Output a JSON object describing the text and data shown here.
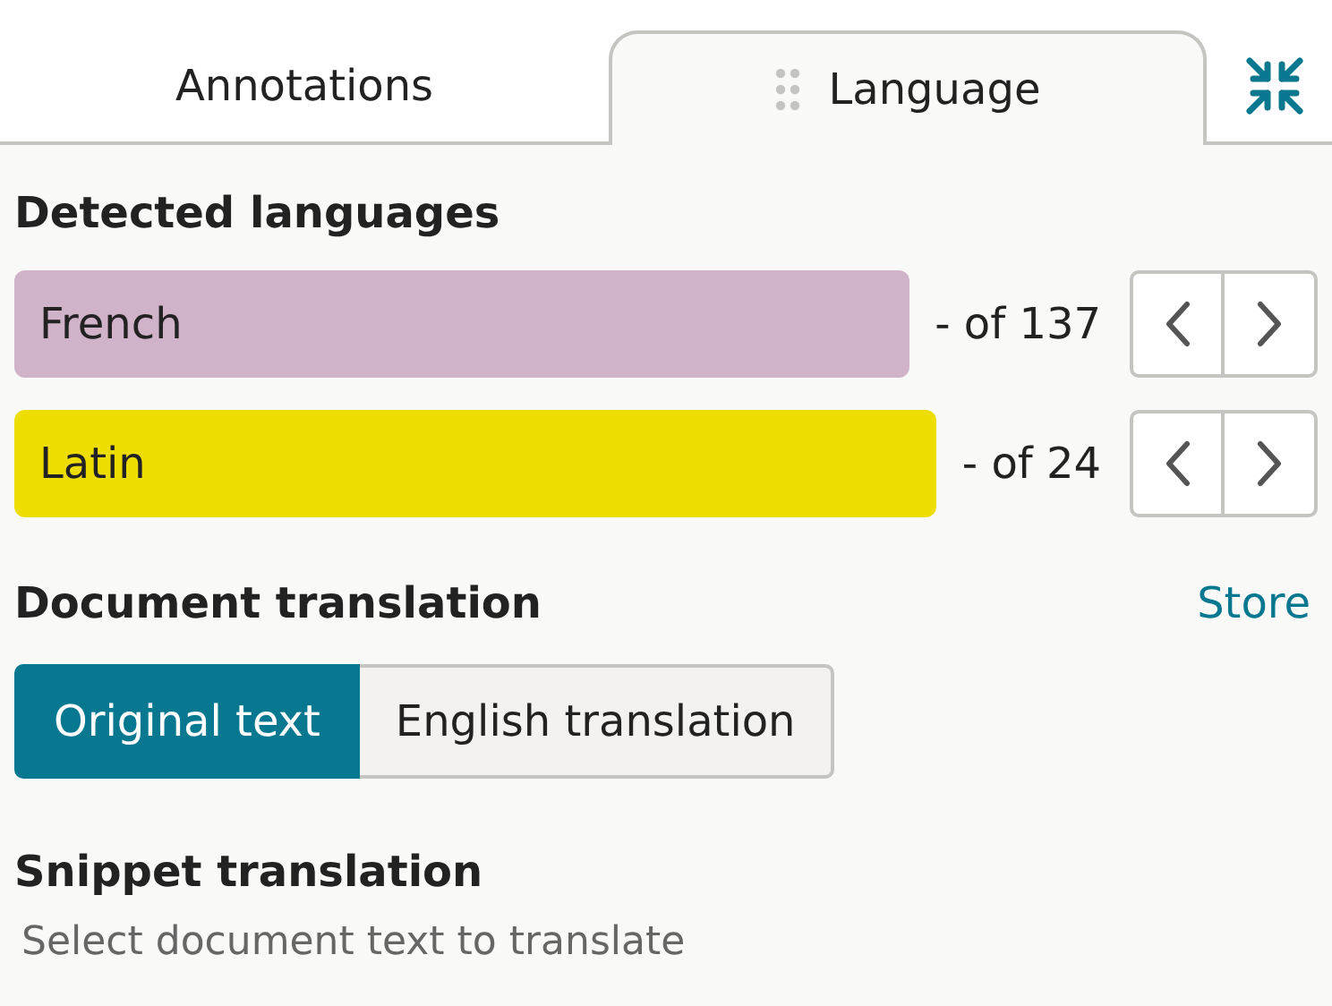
{
  "tabs": [
    {
      "label": "Annotations",
      "selected": false
    },
    {
      "label": "Language",
      "selected": true
    }
  ],
  "detected_languages": {
    "title": "Detected languages",
    "items": [
      {
        "name": "French",
        "color": "#d1b3c9",
        "count": "- of 137"
      },
      {
        "name": "Latin",
        "color": "#eedd00",
        "count": "- of 24"
      }
    ]
  },
  "document_translation": {
    "title": "Document translation",
    "link": "Store",
    "options": [
      {
        "label": "Original text",
        "selected": true
      },
      {
        "label": "English translation",
        "selected": false
      }
    ]
  },
  "snippet_translation": {
    "title": "Snippet translation",
    "placeholder": "Select document text to translate"
  }
}
